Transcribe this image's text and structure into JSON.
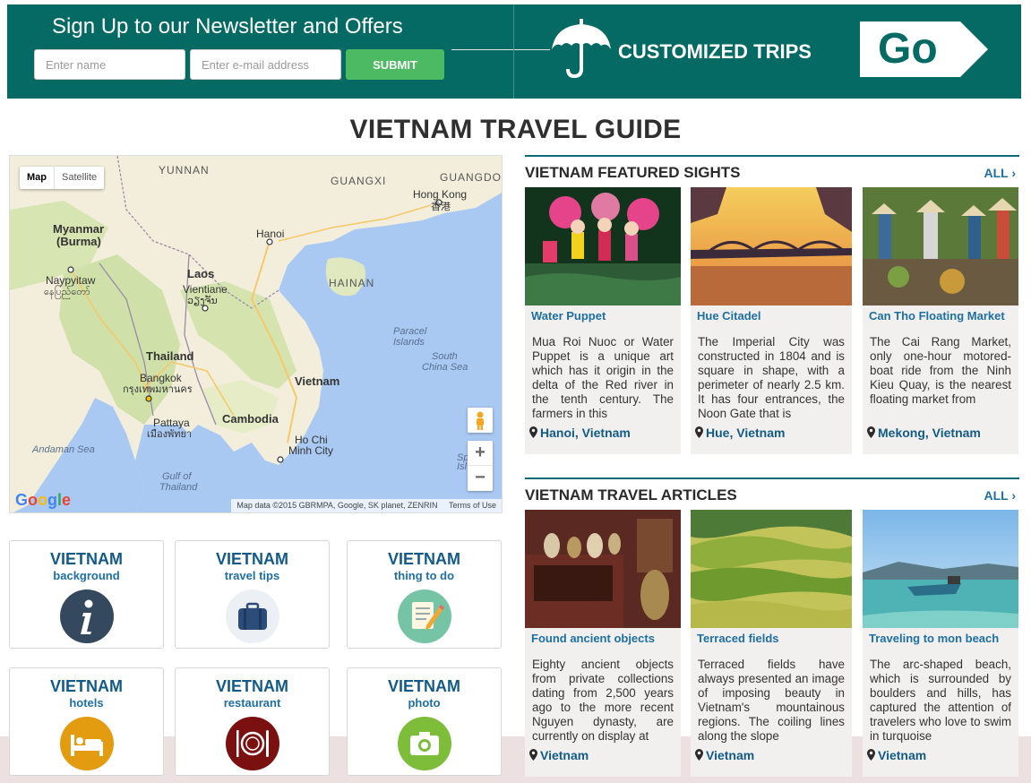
{
  "newsletter": {
    "title": "Sign Up to our Newsletter and Offers",
    "name_placeholder": "Enter name",
    "email_placeholder": "Enter e-mail address",
    "submit_label": "SUBMIT"
  },
  "customized_trips": {
    "label": "CUSTOMIZED TRIPS",
    "go_label": "Go",
    "icon": "umbrella-icon"
  },
  "page_title": "VIETNAM TRAVEL GUIDE",
  "map": {
    "type_options": [
      "Map",
      "Satellite"
    ],
    "selected_type": "Map",
    "zoom_in": "+",
    "zoom_out": "−",
    "logo": "Google",
    "attribution": "Map data ©2015 GBRMPA, Google, SK planet, ZENRIN",
    "terms": "Terms of Use",
    "labels": {
      "yunnan": "YUNNAN",
      "guangxi": "GUANGXI",
      "guangdong": "GUANGDONG",
      "hong_kong": "Hong Kong",
      "hong_kong_local": "香港",
      "myanmar": "Myanmar",
      "burma": "(Burma)",
      "naypyitaw": "Naypyitaw",
      "naypyitaw_local": "နေပြည်တော်",
      "hanoi": "Hanoi",
      "laos": "Laos",
      "vientiane": "Vientiane",
      "vientiane_local": "ວຽງຈັນ",
      "hainan": "HAINAN",
      "paracel": "Paracel",
      "islands": "Islands",
      "south": "South",
      "china_sea": "China Sea",
      "thailand": "Thailand",
      "bangkok": "Bangkok",
      "bangkok_local": "กรุงเทพมหานคร",
      "vietnam": "Vietnam",
      "pattaya": "Pattaya",
      "pattaya_local": "เมืองพัทยา",
      "cambodia": "Cambodia",
      "ho_chi": "Ho Chi",
      "minh_city": "Minh City",
      "andaman_sea": "Andaman Sea",
      "gulf_of": "Gulf of",
      "gulf_thailand": "Thailand",
      "spratly_1": "Sp",
      "spratly_2": "Isl"
    }
  },
  "categories": [
    {
      "title": "VIETNAM",
      "subtitle": "background",
      "icon": "info-icon",
      "color": "#34495e"
    },
    {
      "title": "VIETNAM",
      "subtitle": "travel tips",
      "icon": "suitcase-icon",
      "color": "#ecf0f4"
    },
    {
      "title": "VIETNAM",
      "subtitle": "thing to do",
      "icon": "notepad-pencil-icon",
      "color": "#76c4a6"
    },
    {
      "title": "VIETNAM",
      "subtitle": "hotels",
      "icon": "bed-icon",
      "color": "#e39b10"
    },
    {
      "title": "VIETNAM",
      "subtitle": "restaurant",
      "icon": "plate-cutlery-icon",
      "color": "#7b1010"
    },
    {
      "title": "VIETNAM",
      "subtitle": "photo",
      "icon": "camera-icon",
      "color": "#7dbd3a"
    }
  ],
  "featured_sights": {
    "heading": "VIETNAM FEATURED SIGHTS",
    "all_label": "ALL",
    "items": [
      {
        "title": "Water Puppet",
        "description": "Mua Roi Nuoc or Water Puppet is a unique art which has it origin in the delta of the Red river in the tenth century. The farmers in this",
        "location": "Hanoi, Vietnam"
      },
      {
        "title": "Hue Citadel",
        "description": "The Imperial City was constructed in 1804 and is square in shape, with a perimeter of nearly 2.5 km. It has four entrances, the Noon Gate that is",
        "location": "Hue, Vietnam"
      },
      {
        "title": "Can Tho Floating Market",
        "description": "The Cai Rang Market, only one-hour motored-boat ride from the Ninh Kieu Quay, is the nearest floating market from",
        "location": "Mekong, Vietnam"
      }
    ]
  },
  "travel_articles": {
    "heading": "VIETNAM TRAVEL ARTICLES",
    "all_label": "ALL",
    "items": [
      {
        "title": "Found ancient objects",
        "description": "Eighty ancient objects from private collections dating from 2,500 years ago to the more recent Nguyen dynasty, are currently on display at",
        "location": "Vietnam"
      },
      {
        "title": "Terraced fields",
        "description": "Terraced fields have always presented an image of imposing beauty in Vietnam's mountainous regions. The coiling lines along the slope",
        "location": "Vietnam"
      },
      {
        "title": "Traveling to mon beach",
        "description": "The arc-shaped beach, which is surrounded by boulders and hills, has captured the attention of travelers who love to swim in turquoise",
        "location": "Vietnam"
      }
    ]
  },
  "colors": {
    "brand_teal": "#046a63",
    "submit_green": "#4cba62",
    "link_blue": "#1e6fa3",
    "card_bg": "#f1f0ee"
  }
}
